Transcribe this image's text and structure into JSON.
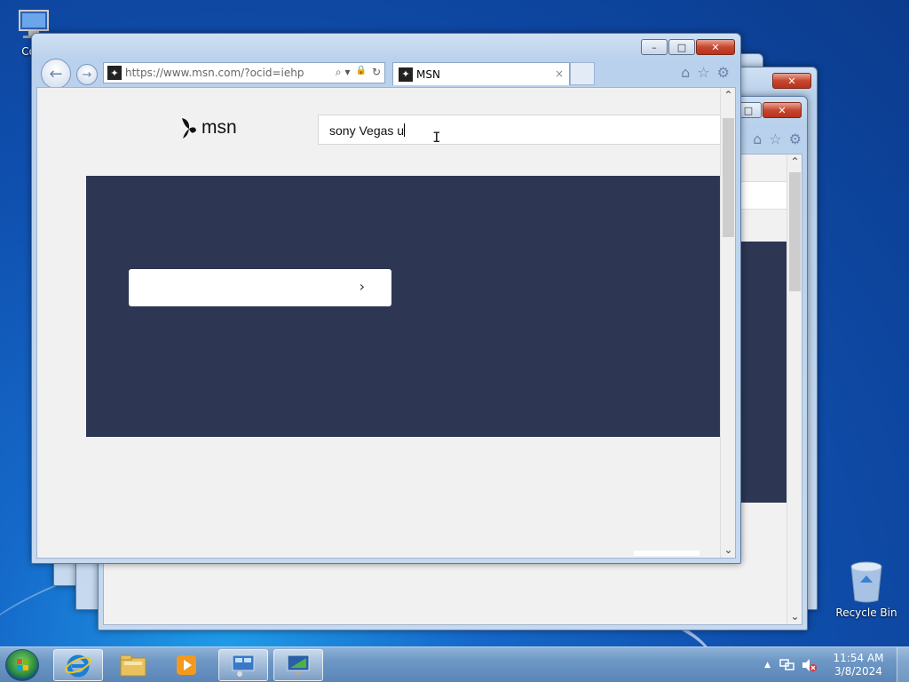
{
  "desktop": {
    "icons": [
      {
        "label": "Com"
      },
      {
        "label": "Recycle Bin"
      }
    ]
  },
  "browser": {
    "address_url": "https://www.msn.com/?ocid=iehp",
    "tab_title": "MSN",
    "tab_close": "×",
    "caption": {
      "minimize": "–",
      "maximize": "□",
      "close": "✕"
    },
    "nav": {
      "back": "←",
      "forward": "→"
    },
    "tools": {
      "search": "⌕ ▾",
      "lock": "🔒",
      "refresh": "↻"
    },
    "right_tools": {
      "home": "⌂",
      "favorites": "☆",
      "settings": "⚙"
    }
  },
  "page": {
    "logo_text": "msn",
    "search_value": "sony Vegas u",
    "ibeam": "I",
    "hero_cta_arrow": "›"
  },
  "scroll": {
    "up": "⌃",
    "down": "⌄"
  },
  "taskbar": {
    "time": "11:54 AM",
    "date": "3/8/2024",
    "tray_expand": "▲"
  }
}
